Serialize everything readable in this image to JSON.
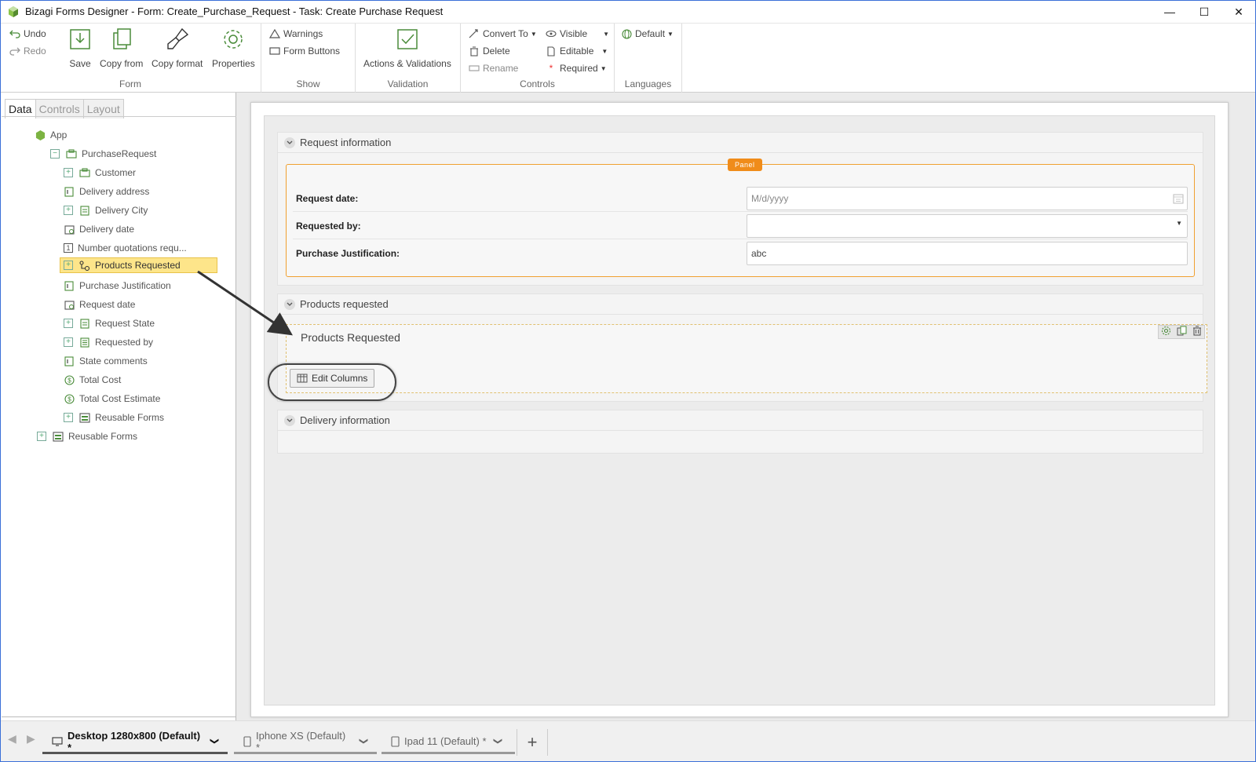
{
  "window": {
    "app_name": "Bizagi Forms Designer",
    "title_rest": " - Form: Create_Purchase_Request - Task:  Create Purchase Request",
    "minimize": "—",
    "maximize": "☐",
    "close": "✕"
  },
  "ribbon": {
    "undo": "Undo",
    "redo": "Redo",
    "save": "Save",
    "copy_from": "Copy from",
    "copy_format": "Copy format",
    "properties": "Properties",
    "form_group": "Form",
    "warnings": "Warnings",
    "form_buttons": "Form Buttons",
    "show_group": "Show",
    "actions_validations": "Actions & Validations",
    "validation_group": "Validation",
    "convert_to": "Convert To",
    "delete": "Delete",
    "rename": "Rename",
    "visible": "Visible",
    "editable": "Editable",
    "required": "Required",
    "controls_group": "Controls",
    "default_lang": "Default",
    "languages_group": "Languages"
  },
  "left_panel": {
    "tabs": [
      "Data",
      "Controls",
      "Layout"
    ],
    "tree": [
      {
        "label": "App"
      },
      {
        "label": "PurchaseRequest"
      },
      {
        "label": "Customer"
      },
      {
        "label": "Delivery address"
      },
      {
        "label": "Delivery City"
      },
      {
        "label": "Delivery date"
      },
      {
        "label": "Number quotations requ..."
      },
      {
        "label": "Products Requested"
      },
      {
        "label": "Purchase Justification"
      },
      {
        "label": "Request date"
      },
      {
        "label": "Request State"
      },
      {
        "label": "Requested by"
      },
      {
        "label": "State comments"
      },
      {
        "label": "Total Cost"
      },
      {
        "label": "Total Cost Estimate"
      },
      {
        "label": "Reusable Forms"
      },
      {
        "label": "Reusable Forms"
      }
    ]
  },
  "form": {
    "request_info_title": "Request information",
    "panel_badge": "Panel",
    "request_date_label": "Request date:",
    "request_date_placeholder": "M/d/yyyy",
    "requested_by_label": "Requested by:",
    "justification_label": "Purchase Justification:",
    "justification_value": "abc",
    "products_section_title": "Products requested",
    "grid_title": "Products Requested",
    "edit_columns": "Edit Columns",
    "delivery_section_title": "Delivery information"
  },
  "devices": {
    "desktop": "Desktop 1280x800 (Default) *",
    "iphone": "Iphone XS (Default) *",
    "ipad": "Ipad 11 (Default) *",
    "add": "+"
  },
  "colors": {
    "accent_orange": "#f08c1a",
    "selection": "#fde58a",
    "logo_green": "#7cb342"
  }
}
